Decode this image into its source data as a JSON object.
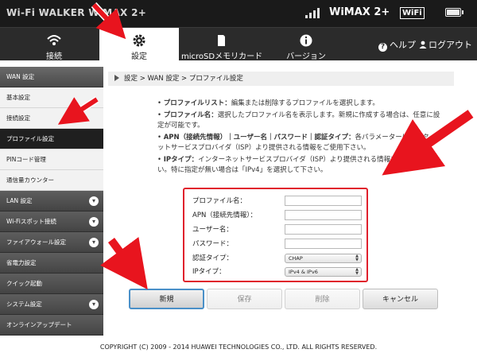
{
  "header": {
    "brand": "Wi-Fi WALKER WiMAX 2+",
    "network": "WiMAX 2+",
    "wifi_badge": "WiFi"
  },
  "nav": {
    "tabs": [
      {
        "label": "接続",
        "icon": "wifi-icon"
      },
      {
        "label": "設定",
        "icon": "gear-icon"
      },
      {
        "label": "microSDメモリカード",
        "icon": "sdcard-icon"
      },
      {
        "label": "バージョン",
        "icon": "info-icon"
      }
    ],
    "active_tab": "設定",
    "help": "ヘルプ",
    "logout": "ログアウト"
  },
  "sidebar": {
    "group": "WAN 設定",
    "sub_items": [
      "基本設定",
      "接続設定",
      "プロファイル設定",
      "PINコード管理",
      "通信量カウンター"
    ],
    "selected": "プロファイル設定",
    "items": [
      {
        "label": "LAN 設定",
        "expandable": true
      },
      {
        "label": "Wi-Fiスポット接続",
        "expandable": true
      },
      {
        "label": "ファイアウォール設定",
        "expandable": true
      },
      {
        "label": "省電力設定",
        "expandable": false
      },
      {
        "label": "クイック起動",
        "expandable": false
      },
      {
        "label": "システム設定",
        "expandable": true
      },
      {
        "label": "オンラインアップデート",
        "expandable": false
      }
    ]
  },
  "breadcrumb": "設定 > WAN 設定 > プロファイル設定",
  "descriptions": [
    {
      "term": "プロファイルリスト：",
      "text": "編集または削除するプロファイルを選択します。"
    },
    {
      "term": "プロファイル名：",
      "text": "選択したプロファイル名を表示します。新規に作成する場合は、任意に設定が可能です。"
    },
    {
      "term": "APN（接続先情報）｜ユーザー名｜パスワード｜認証タイプ：",
      "text": "各パラメーターはインターネットサービスプロバイダ（ISP）より提供される情報をご使用下さい。"
    },
    {
      "term": "IPタイプ：",
      "text": "インターネットサービスプロバイダ（ISP）より提供される情報をご使用下さい。特に指定が無い場合は「IPv4」を選択して下さい。"
    }
  ],
  "form": {
    "profile_name_label": "プロファイル名：",
    "apn_label": "APN（接続先情報）：",
    "username_label": "ユーザー名：",
    "password_label": "パスワード：",
    "auth_type_label": "認証タイプ：",
    "auth_type_value": "CHAP",
    "ip_type_label": "IPタイプ：",
    "ip_type_value": "IPv4 & IPv6",
    "profile_name_value": "",
    "apn_value": "",
    "username_value": "",
    "password_value": ""
  },
  "buttons": {
    "new": "新規",
    "save": "保存",
    "delete": "削除",
    "cancel": "キャンセル"
  },
  "footer": "COPYRIGHT (C) 2009 - 2014 HUAWEI TECHNOLOGIES CO., LTD. ALL RIGHTS RESERVED.",
  "colors": {
    "annotation_arrow": "#e8141e",
    "form_border": "#e0202c",
    "primary_button_border": "#4a90c8"
  }
}
